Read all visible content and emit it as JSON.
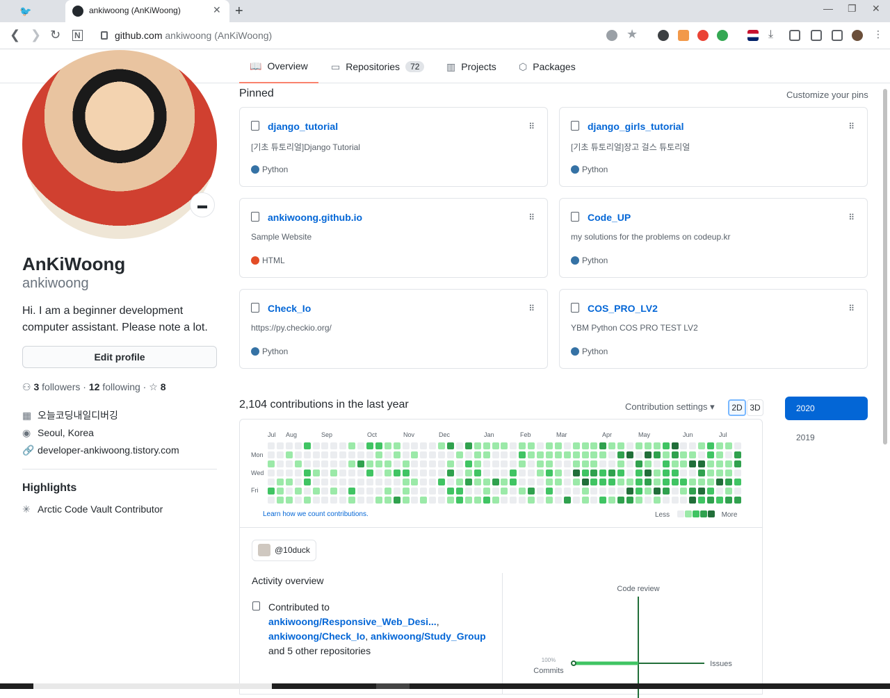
{
  "browser": {
    "tab_title": "ankiwoong (AnKiWoong)",
    "url_domain": "github.com",
    "url_rest": "ankiwoong (AnKiWoong)"
  },
  "nav": {
    "tabs": [
      {
        "label": "Overview",
        "icon": "book-icon",
        "selected": true
      },
      {
        "label": "Repositories",
        "icon": "repo-icon",
        "count": "72"
      },
      {
        "label": "Projects",
        "icon": "project-icon"
      },
      {
        "label": "Packages",
        "icon": "package-icon"
      }
    ]
  },
  "profile": {
    "name": "AnKiWoong",
    "login": "ankiwoong",
    "bio": "Hi. I am a beginner development computer assistant. Please note a lot.",
    "edit_button": "Edit profile",
    "followers_count": "3",
    "followers_label": "followers",
    "following_count": "12",
    "following_label": "following",
    "stars_count": "8",
    "organization": "오늘코딩내일디버깅",
    "location": "Seoul, Korea",
    "website": "developer-ankiwoong.tistory.com",
    "highlights_title": "Highlights",
    "highlight_item": "Arctic Code Vault Contributor"
  },
  "pinned": {
    "title": "Pinned",
    "customize": "Customize your pins",
    "repos": [
      {
        "name": "django_tutorial",
        "desc": "[기초 튜토리얼]Django Tutorial",
        "lang": "Python",
        "color": "#3572A5"
      },
      {
        "name": "django_girls_tutorial",
        "desc": "[기초 튜토리얼]장고 걸스 튜토리얼",
        "lang": "Python",
        "color": "#3572A5"
      },
      {
        "name": "ankiwoong.github.io",
        "desc": "Sample Website",
        "lang": "HTML",
        "color": "#e34c26"
      },
      {
        "name": "Code_UP",
        "desc": "my solutions for the problems on codeup.kr",
        "lang": "Python",
        "color": "#3572A5"
      },
      {
        "name": "Check_Io",
        "desc": "https://py.checkio.org/",
        "lang": "Python",
        "color": "#3572A5"
      },
      {
        "name": "COS_PRO_LV2",
        "desc": "YBM Python COS PRO TEST LV2",
        "lang": "Python",
        "color": "#3572A5"
      }
    ]
  },
  "contributions": {
    "title": "2,104 contributions in the last year",
    "settings": "Contribution settings ▾",
    "view_2d": "2D",
    "view_3d": "3D",
    "months": [
      "Jul",
      "Aug",
      "Sep",
      "Oct",
      "Nov",
      "Dec",
      "Jan",
      "Feb",
      "Mar",
      "Apr",
      "May",
      "Jun",
      "Jul"
    ],
    "days": [
      "Mon",
      "Wed",
      "Fri"
    ],
    "learn": "Learn how we count contributions.",
    "less": "Less",
    "more": "More",
    "colors": [
      "#ebedf0",
      "#9be9a8",
      "#40c463",
      "#30a14e",
      "#216e39"
    ]
  },
  "activity": {
    "org": "@10duck",
    "overview_title": "Activity overview",
    "contributed_to": "Contributed to",
    "repo1": "ankiwoong/Responsive_Web_Desi...",
    "repo2": "ankiwoong/Check_Io",
    "repo3": "ankiwoong/Study_Group",
    "other": "and 5 other repositories",
    "code_review": "Code review",
    "issues": "Issues",
    "commits": "Commits",
    "commits_pct": "100%"
  },
  "years": [
    "2020",
    "2019"
  ]
}
